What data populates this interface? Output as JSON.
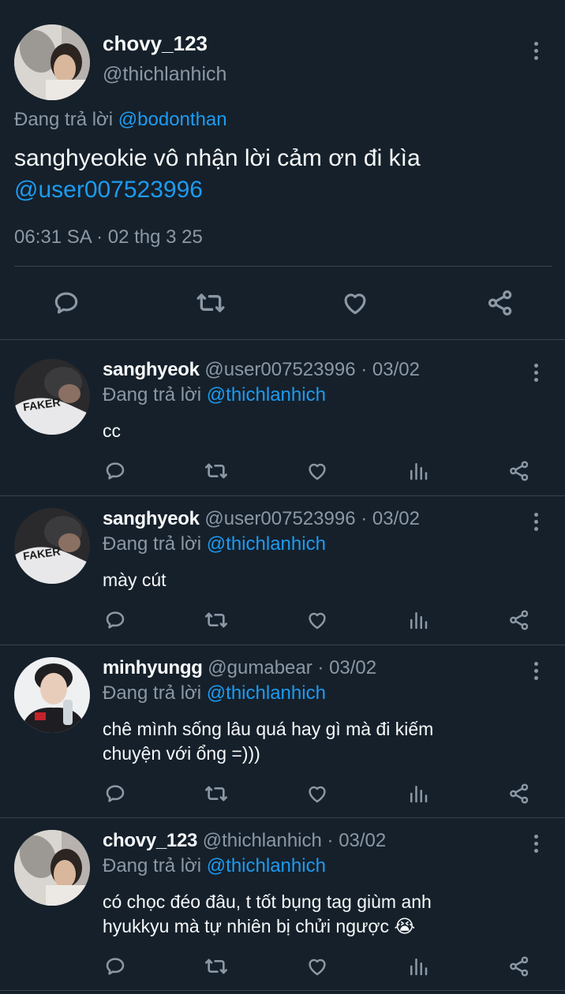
{
  "main": {
    "display_name": "chovy_123",
    "handle": "@thichlanhich",
    "replying_prefix": "Đang trả lời",
    "replying_to": "@bodonthan",
    "text": "sanghyeokie vô nhận lời cảm ơn đi kìa",
    "mention": "@user007523996",
    "timestamp": "06:31 SA · 02 thg 3 25",
    "actions": [
      "reply-icon",
      "retweet-icon",
      "like-icon",
      "share-icon"
    ]
  },
  "replies": [
    {
      "display_name": "sanghyeok",
      "handle": "@user007523996",
      "date": "· 03/02",
      "replying_prefix": "Đang trả lời",
      "replying_to": "@thichlanhich",
      "text": "cc",
      "avatar": "faker-avatar"
    },
    {
      "display_name": "sanghyeok",
      "handle": "@user007523996",
      "date": "· 03/02",
      "replying_prefix": "Đang trả lời",
      "replying_to": "@thichlanhich",
      "text": "mày cút",
      "avatar": "faker-avatar"
    },
    {
      "display_name": "minhyungg",
      "handle": "@gumabear",
      "date": "· 03/02",
      "replying_prefix": "Đang trả lời",
      "replying_to": "@thichlanhich",
      "text_line1": "chê mình sống lâu quá hay gì mà đi kiếm",
      "text_line2": "chuyện với ổng =)))",
      "avatar": "person-avatar"
    },
    {
      "display_name": "chovy_123",
      "handle": "@thichlanhich",
      "date": "· 03/02",
      "replying_prefix": "Đang trả lời",
      "replying_to": "@thichlanhich",
      "text_line1": "có chọc đéo đâu, t tốt bụng tag giùm anh",
      "text_line2": "hyukkyu mà tự nhiên bị chửi ngược",
      "emoji": "😭",
      "avatar": "chovy-avatar"
    }
  ],
  "colors": {
    "background": "#15202b",
    "text": "#f7f9f9",
    "muted": "#8b98a5",
    "link": "#1d9bf0",
    "divider": "#38444d"
  }
}
